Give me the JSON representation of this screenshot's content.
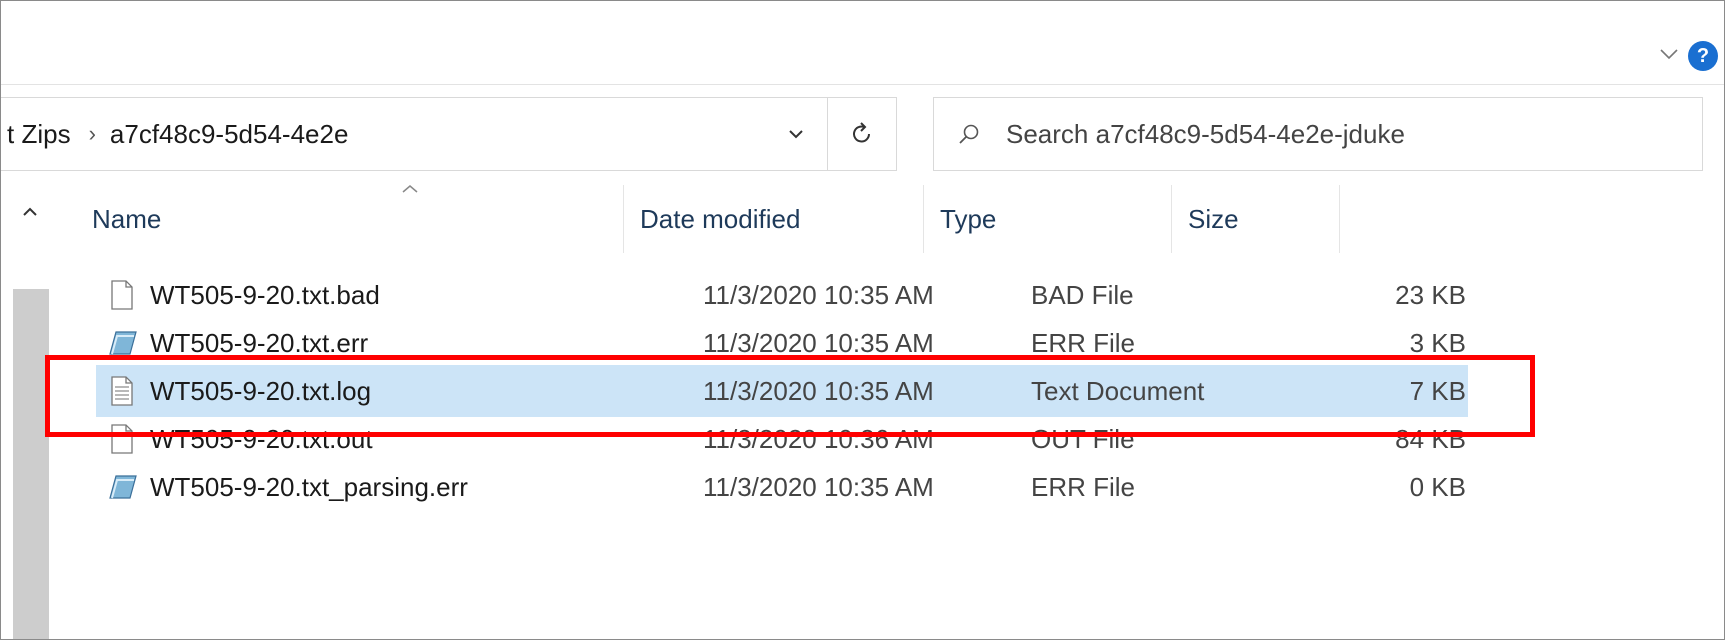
{
  "address_bar": {
    "crumbs": [
      "t Zips",
      "a7cf48c9-5d54-4e2e"
    ]
  },
  "search": {
    "placeholder": "Search a7cf48c9-5d54-4e2e-jduke"
  },
  "columns": {
    "name": "Name",
    "date": "Date modified",
    "type": "Type",
    "size": "Size"
  },
  "files": [
    {
      "name": "WT505-9-20.txt.bad",
      "date": "11/3/2020 10:35 AM",
      "type": "BAD File",
      "size": "23 KB",
      "icon": "blank-file-icon"
    },
    {
      "name": "WT505-9-20.txt.err",
      "date": "11/3/2020 10:35 AM",
      "type": "ERR File",
      "size": "3 KB",
      "icon": "err-file-icon"
    },
    {
      "name": "WT505-9-20.txt.log",
      "date": "11/3/2020 10:35 AM",
      "type": "Text Document",
      "size": "7 KB",
      "icon": "text-document-icon",
      "selected": true
    },
    {
      "name": "WT505-9-20.txt.out",
      "date": "11/3/2020 10:36 AM",
      "type": "OUT File",
      "size": "84 KB",
      "icon": "blank-file-icon"
    },
    {
      "name": "WT505-9-20.txt_parsing.err",
      "date": "11/3/2020 10:35 AM",
      "type": "ERR File",
      "size": "0 KB",
      "icon": "err-file-icon"
    }
  ],
  "colors": {
    "selection": "#cce4f7",
    "highlight_box": "#ff0000",
    "help_button": "#1a6fd1"
  },
  "help": {
    "label": "?"
  }
}
